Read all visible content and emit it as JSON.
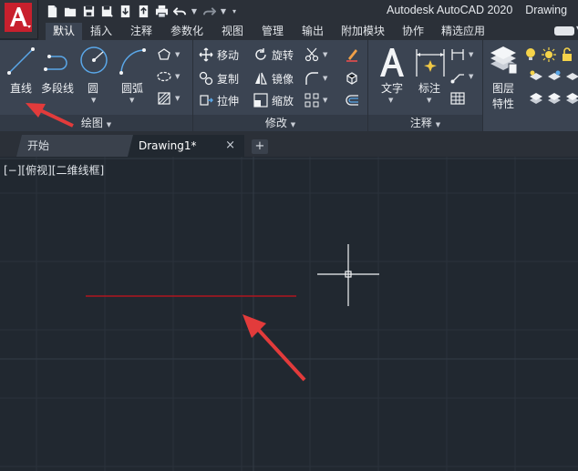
{
  "window": {
    "app_title": "Autodesk AutoCAD 2020",
    "doc_title_fragment": "Drawing"
  },
  "app_button": {
    "icon": "autocad-a-logo-icon",
    "brand_color": "#c8202d"
  },
  "quick_access": {
    "buttons": [
      {
        "name": "new-file-icon"
      },
      {
        "name": "open-file-icon"
      },
      {
        "name": "save-icon"
      },
      {
        "name": "save-as-icon"
      },
      {
        "name": "open-from-web-icon"
      },
      {
        "name": "save-to-web-icon"
      },
      {
        "name": "plot-icon"
      },
      {
        "name": "undo-icon"
      },
      {
        "name": "redo-icon"
      },
      {
        "name": "customize-qat-icon"
      }
    ]
  },
  "ribbon_tabs": [
    {
      "label": "默认",
      "active": true
    },
    {
      "label": "插入"
    },
    {
      "label": "注释"
    },
    {
      "label": "参数化"
    },
    {
      "label": "视图"
    },
    {
      "label": "管理"
    },
    {
      "label": "输出"
    },
    {
      "label": "附加模块"
    },
    {
      "label": "协作"
    },
    {
      "label": "精选应用"
    }
  ],
  "panels": {
    "draw": {
      "title": "绘图",
      "line": "直线",
      "polyline": "多段线",
      "circle": "圆",
      "arc": "圆弧"
    },
    "modify": {
      "title": "修改",
      "move": "移动",
      "rotate": "旋转",
      "copy": "复制",
      "mirror": "镜像",
      "stretch": "拉伸",
      "scale": "缩放"
    },
    "annotation": {
      "title": "注释",
      "text": "文字",
      "dimension": "标注"
    },
    "layers": {
      "properties_line1": "图层",
      "properties_line2": "特性"
    }
  },
  "file_tabs": [
    {
      "label": "开始"
    },
    {
      "label": "Drawing1*",
      "active": true,
      "close": "×"
    }
  ],
  "add_tab": "+",
  "canvas": {
    "view_label": "[−][俯视][二维线框]",
    "background": "#212830",
    "drawn_line_color": "#b0151f",
    "annotation_arrow_color": "#e23b3b"
  }
}
